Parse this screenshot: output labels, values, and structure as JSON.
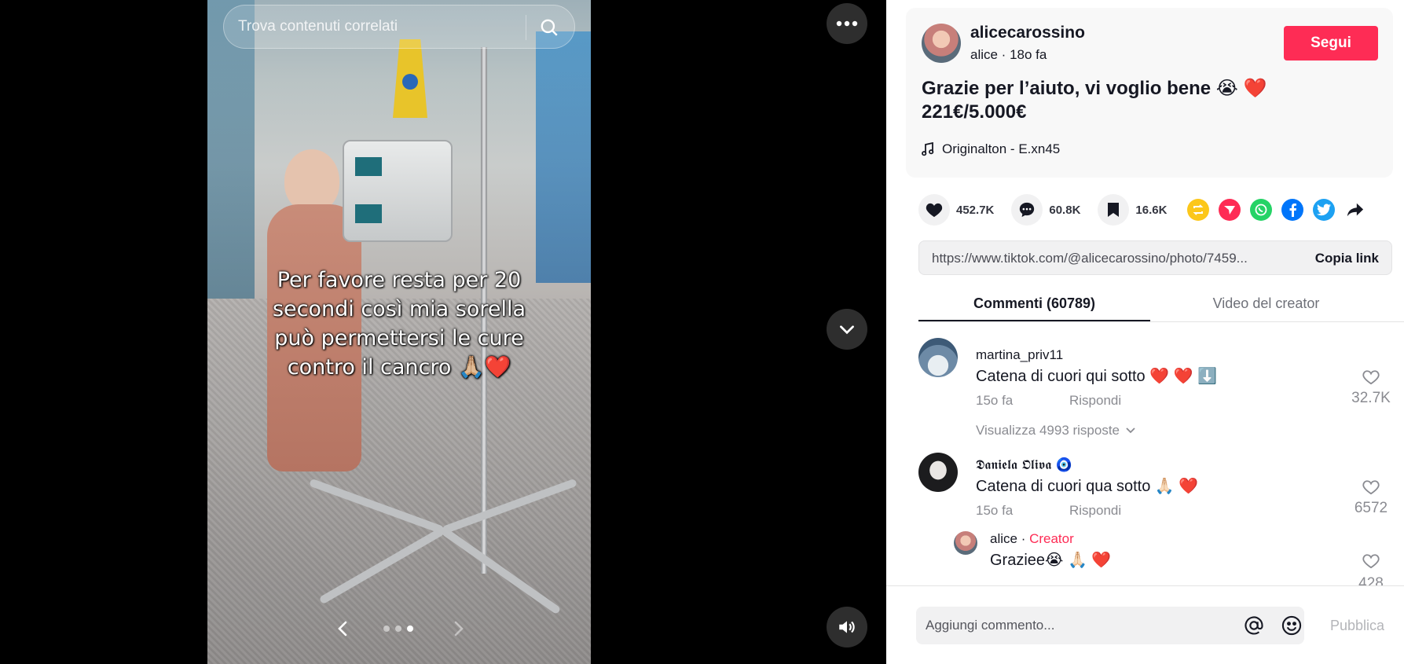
{
  "search": {
    "placeholder": "Trova contenuti correlati"
  },
  "post": {
    "caption_lines": [
      "Per favore resta per 20",
      "secondi così mia sorella",
      "può permettersi le cure",
      "contro il cancro 🙏🏼❤️"
    ],
    "slides": {
      "count": 3,
      "active": 3
    }
  },
  "author": {
    "username": "alicecarossino",
    "nickname_time": "alice · 18o fa",
    "follow_label": "Segui"
  },
  "description": {
    "line1": "Grazie per l’aiuto, vi voglio bene 😭 ❤️",
    "line2": "221€/5.000€"
  },
  "music": {
    "label": "Originalton - E.xn45"
  },
  "stats": {
    "likes": "452.7K",
    "comments": "60.8K",
    "saves": "16.6K"
  },
  "share_icons": [
    "repost-icon",
    "send-icon",
    "whatsapp-icon",
    "facebook-icon",
    "twitter-icon",
    "share-arrow-icon"
  ],
  "share_colors": {
    "repost": "#fcc71a",
    "send": "#fe2c55",
    "whatsapp": "#25d366",
    "facebook": "#0075fa",
    "twitter": "#1da1f2"
  },
  "link": {
    "url": "https://www.tiktok.com/@alicecarossino/photo/7459...",
    "copy_label": "Copia link"
  },
  "tabs": [
    {
      "label": "Commenti (60789)"
    },
    {
      "label": "Video del creator"
    }
  ],
  "comments": [
    {
      "user": "martina_priv11",
      "text": "Catena di cuori qui sotto ❤️ ❤️ ⬇️",
      "time": "15o fa",
      "reply_label": "Rispondi",
      "likes": "32.7K",
      "view_replies": "Visualizza 4993 risposte"
    },
    {
      "user": "𝕯𝖆𝖓𝖎𝖊𝖑𝖆 𝕺𝖑𝖎𝖛𝖆 🧿",
      "text": "Catena di cuori qua sotto 🙏🏻 ❤️",
      "time": "15o fa",
      "reply_label": "Rispondi",
      "likes": "6572"
    }
  ],
  "reply": {
    "user": "alice",
    "separator": " · ",
    "badge": "Creator",
    "text": "Graziee😭 🙏🏻 ❤️",
    "likes": "428"
  },
  "composer": {
    "placeholder": "Aggiungi commento...",
    "publish_label": "Pubblica"
  },
  "colors": {
    "accent": "#fe2c55",
    "stage_bg": "#000000",
    "text": "#161823",
    "muted": "#8a8b91"
  }
}
